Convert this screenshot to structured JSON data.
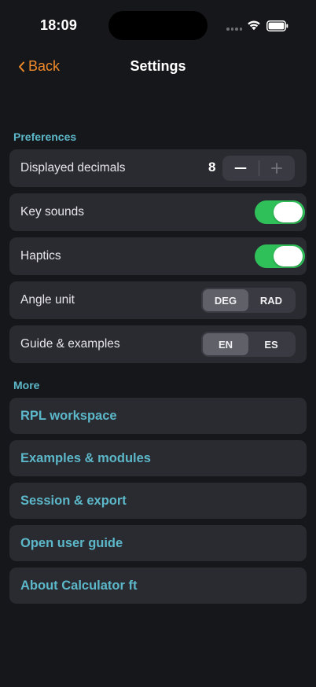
{
  "status_bar": {
    "time": "18:09"
  },
  "nav": {
    "back_label": "Back",
    "title": "Settings"
  },
  "preferences": {
    "header": "Preferences",
    "displayed_decimals": {
      "label": "Displayed decimals",
      "value": "8"
    },
    "key_sounds": {
      "label": "Key sounds",
      "enabled": true
    },
    "haptics": {
      "label": "Haptics",
      "enabled": true
    },
    "angle_unit": {
      "label": "Angle unit",
      "options": [
        "DEG",
        "RAD"
      ],
      "selected": "DEG"
    },
    "guide_language": {
      "label": "Guide & examples",
      "options": [
        "EN",
        "ES"
      ],
      "selected": "EN"
    }
  },
  "more": {
    "header": "More",
    "items": [
      {
        "label": "RPL workspace"
      },
      {
        "label": "Examples & modules"
      },
      {
        "label": "Session & export"
      },
      {
        "label": "Open user guide"
      },
      {
        "label": "About Calculator ft"
      }
    ]
  },
  "colors": {
    "accent_orange": "#f08a2a",
    "accent_teal": "#5cb8c9",
    "toggle_on": "#30c05a",
    "card_bg": "#2a2b31"
  }
}
